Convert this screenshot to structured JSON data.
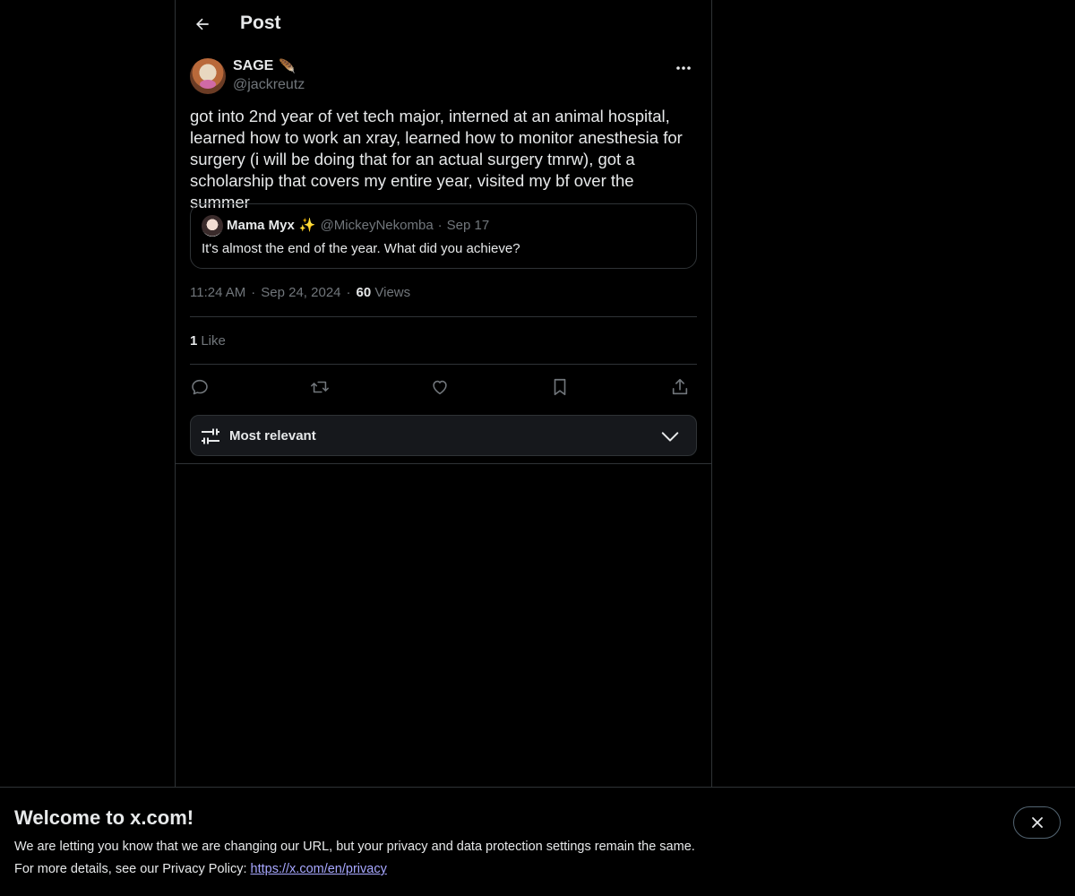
{
  "header": {
    "title": "Post",
    "back_icon": "arrow-left-icon"
  },
  "post": {
    "author": {
      "display_name": "SAGE",
      "name_emoji": "🪶",
      "handle": "@jackreutz"
    },
    "more_icon": "ellipsis-icon",
    "text": "got into 2nd year of vet tech major, interned at an animal hospital, learned how to work an xray, learned how to monitor anesthesia for surgery (i will be doing that for an actual surgery tmrw), got a scholarship that covers my entire year, visited my bf over the summer",
    "quote": {
      "display_name": "Mama Myx",
      "name_emoji": "✨",
      "handle": "@MickeyNekomba",
      "separator": "·",
      "date": "Sep 17",
      "text": "It's almost the end of the year. What did you achieve?"
    },
    "meta": {
      "time": "11:24 AM",
      "separator": "·",
      "date": "Sep 24, 2024",
      "views_count": "60",
      "views_label": "Views"
    },
    "likes": {
      "count": "1",
      "label": "Like"
    },
    "actions": [
      "reply-icon",
      "repost-icon",
      "like-icon",
      "bookmark-icon",
      "share-icon"
    ]
  },
  "sort": {
    "label": "Most relevant",
    "icon": "sliders-icon",
    "chevron": "chevron-down-icon"
  },
  "banner": {
    "title": "Welcome to x.com!",
    "line1": "We are letting you know that we are changing our URL, but your privacy and data protection settings remain the same.",
    "line2_prefix": "For more details, see our Privacy Policy: ",
    "link_text": "https://x.com/en/privacy",
    "close_icon": "close-icon"
  },
  "colors": {
    "background": "#000000",
    "text": "#e7e9ea",
    "muted": "#71767b",
    "border": "#2f3336",
    "link": "#a7a7ff"
  }
}
